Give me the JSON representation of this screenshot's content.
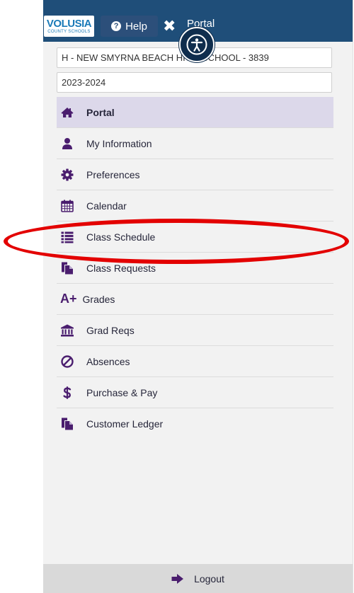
{
  "header": {
    "logo_main": "VOLUSIA",
    "logo_sub": "COUNTY SCHOOLS",
    "help_label": "Help",
    "title": "Portal"
  },
  "school_select": {
    "value": "H - NEW SMYRNA BEACH HIGH SCHOOL - 3839"
  },
  "year_select": {
    "value": "2023-2024"
  },
  "menu": {
    "items": [
      {
        "label": "Portal",
        "icon": "home-icon",
        "active": true
      },
      {
        "label": "My Information",
        "icon": "user-icon"
      },
      {
        "label": "Preferences",
        "icon": "gear-icon"
      },
      {
        "label": "Calendar",
        "icon": "calendar-icon"
      },
      {
        "label": "Class Schedule",
        "icon": "list-icon"
      },
      {
        "label": "Class Requests",
        "icon": "documents-icon"
      },
      {
        "label": "Grades",
        "icon": "a-plus-icon",
        "icon_text": "A+"
      },
      {
        "label": "Grad Reqs",
        "icon": "institution-icon"
      },
      {
        "label": "Absences",
        "icon": "ban-icon"
      },
      {
        "label": "Purchase & Pay",
        "icon": "dollar-icon"
      },
      {
        "label": "Customer Ledger",
        "icon": "documents-icon"
      }
    ]
  },
  "footer": {
    "logout_label": "Logout"
  },
  "colors": {
    "topbar": "#1f4e79",
    "icon_purple": "#4a1d6e",
    "active_bg": "#dcd8ea",
    "highlight_red": "#e30000"
  }
}
